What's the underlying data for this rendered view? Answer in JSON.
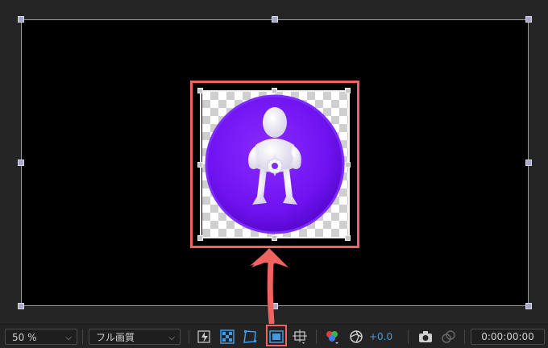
{
  "toolbar": {
    "zoom_value": "50 %",
    "resolution_value": "フル画質",
    "exposure_value": "+0.0",
    "timecode_value": "0:00:00:00"
  },
  "icons": {
    "fast_preview": "fast-preview-icon",
    "transparency_grid": "transparency-grid-icon",
    "mask_visibility": "mask-path-visibility-icon",
    "region_of_interest": "region-of-interest-icon",
    "guides": "grid-guides-icon",
    "channel": "rgb-channel-icon",
    "exposure": "exposure-reset-icon",
    "snapshot": "camera-snapshot-icon",
    "show_snapshot": "show-snapshot-icon"
  },
  "colors": {
    "accent_blue": "#3f9be6",
    "annotation_red": "#ef6461",
    "logo_purple": "#6e12f0"
  }
}
